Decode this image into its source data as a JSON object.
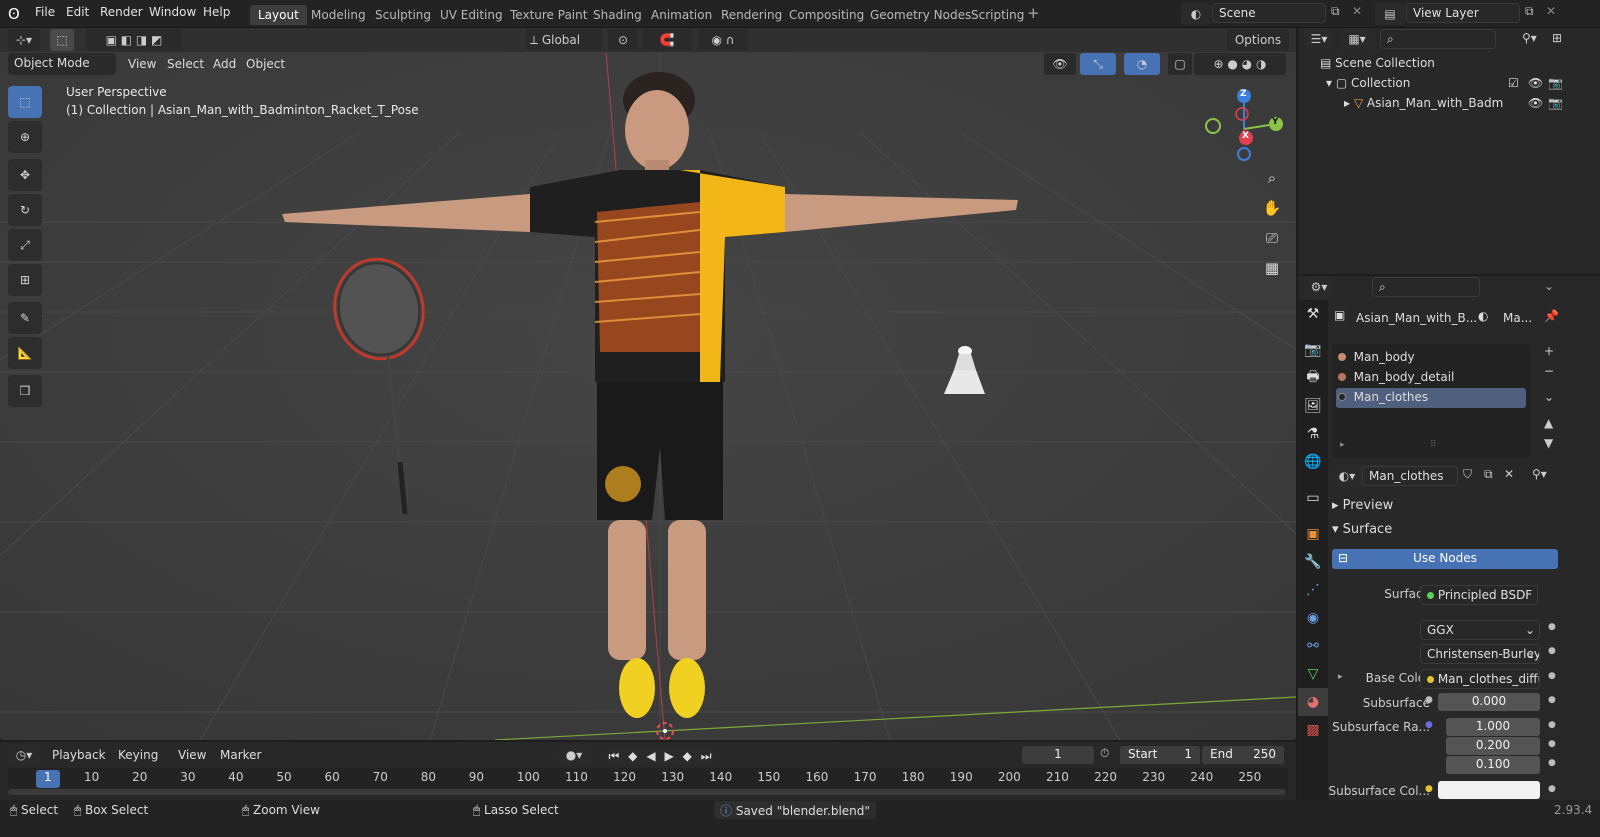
{
  "menu": [
    "File",
    "Edit",
    "Render",
    "Window",
    "Help"
  ],
  "workspaces": [
    "Layout",
    "Modeling",
    "Sculpting",
    "UV Editing",
    "Texture Paint",
    "Shading",
    "Animation",
    "Rendering",
    "Compositing",
    "Geometry Nodes",
    "Scripting"
  ],
  "active_workspace": "Layout",
  "scene": {
    "label": "Scene",
    "view_layer": "View Layer"
  },
  "toolbar": {
    "transform_orientation": "Global",
    "options": "Options"
  },
  "viewport_header": {
    "mode": "Object Mode",
    "menus": [
      "View",
      "Select",
      "Add",
      "Object"
    ]
  },
  "viewport": {
    "title": "User Perspective",
    "collection_info": "(1) Collection | Asian_Man_with_Badminton_Racket_T_Pose"
  },
  "gizmo": {
    "z": "Z",
    "y": "Y",
    "x": "X"
  },
  "outliner": {
    "root": "Scene Collection",
    "collection": "Collection",
    "object": "Asian_Man_with_Badmin"
  },
  "properties": {
    "object_name": "Asian_Man_with_B...",
    "material_tab": "Ma...",
    "materials": [
      "Man_body",
      "Man_body_detail",
      "Man_clothes"
    ],
    "selected_material": "Man_clothes",
    "material_field": "Man_clothes",
    "panels": {
      "preview": "Preview",
      "surface": "Surface"
    },
    "use_nodes": "Use Nodes",
    "surface_label": "Surface",
    "surface_value": "Principled BSDF",
    "distribution": "GGX",
    "subsurface_method": "Christensen-Burley",
    "base_color_label": "Base Color",
    "base_color_value": "Man_clothes_diffus...",
    "subsurface_label": "Subsurface",
    "subsurface_value": "0.000",
    "subsurface_radius_label": "Subsurface Ra...",
    "subsurface_radius": [
      "1.000",
      "0.200",
      "0.100"
    ],
    "subsurface_color_label": "Subsurface Col..."
  },
  "timeline": {
    "menus": [
      "Playback",
      "Keying",
      "View",
      "Marker"
    ],
    "current_frame": "1",
    "start_label": "Start",
    "start": "1",
    "end_label": "End",
    "end": "250",
    "ticks": [
      "1",
      "10",
      "20",
      "30",
      "40",
      "50",
      "60",
      "70",
      "80",
      "90",
      "100",
      "110",
      "120",
      "130",
      "140",
      "150",
      "160",
      "170",
      "180",
      "190",
      "200",
      "210",
      "220",
      "230",
      "240",
      "250"
    ]
  },
  "status": {
    "select": "Select",
    "box_select": "Box Select",
    "zoom_view": "Zoom View",
    "lasso_select": "Lasso Select",
    "message": "Saved \"blender.blend\"",
    "version": "2.93.4"
  },
  "colors": {
    "accent": "#4772b3",
    "x_axis": "#e04050",
    "y_axis": "#8bc34a",
    "z_axis": "#3d7fe0",
    "background": "#3b3b3b"
  }
}
